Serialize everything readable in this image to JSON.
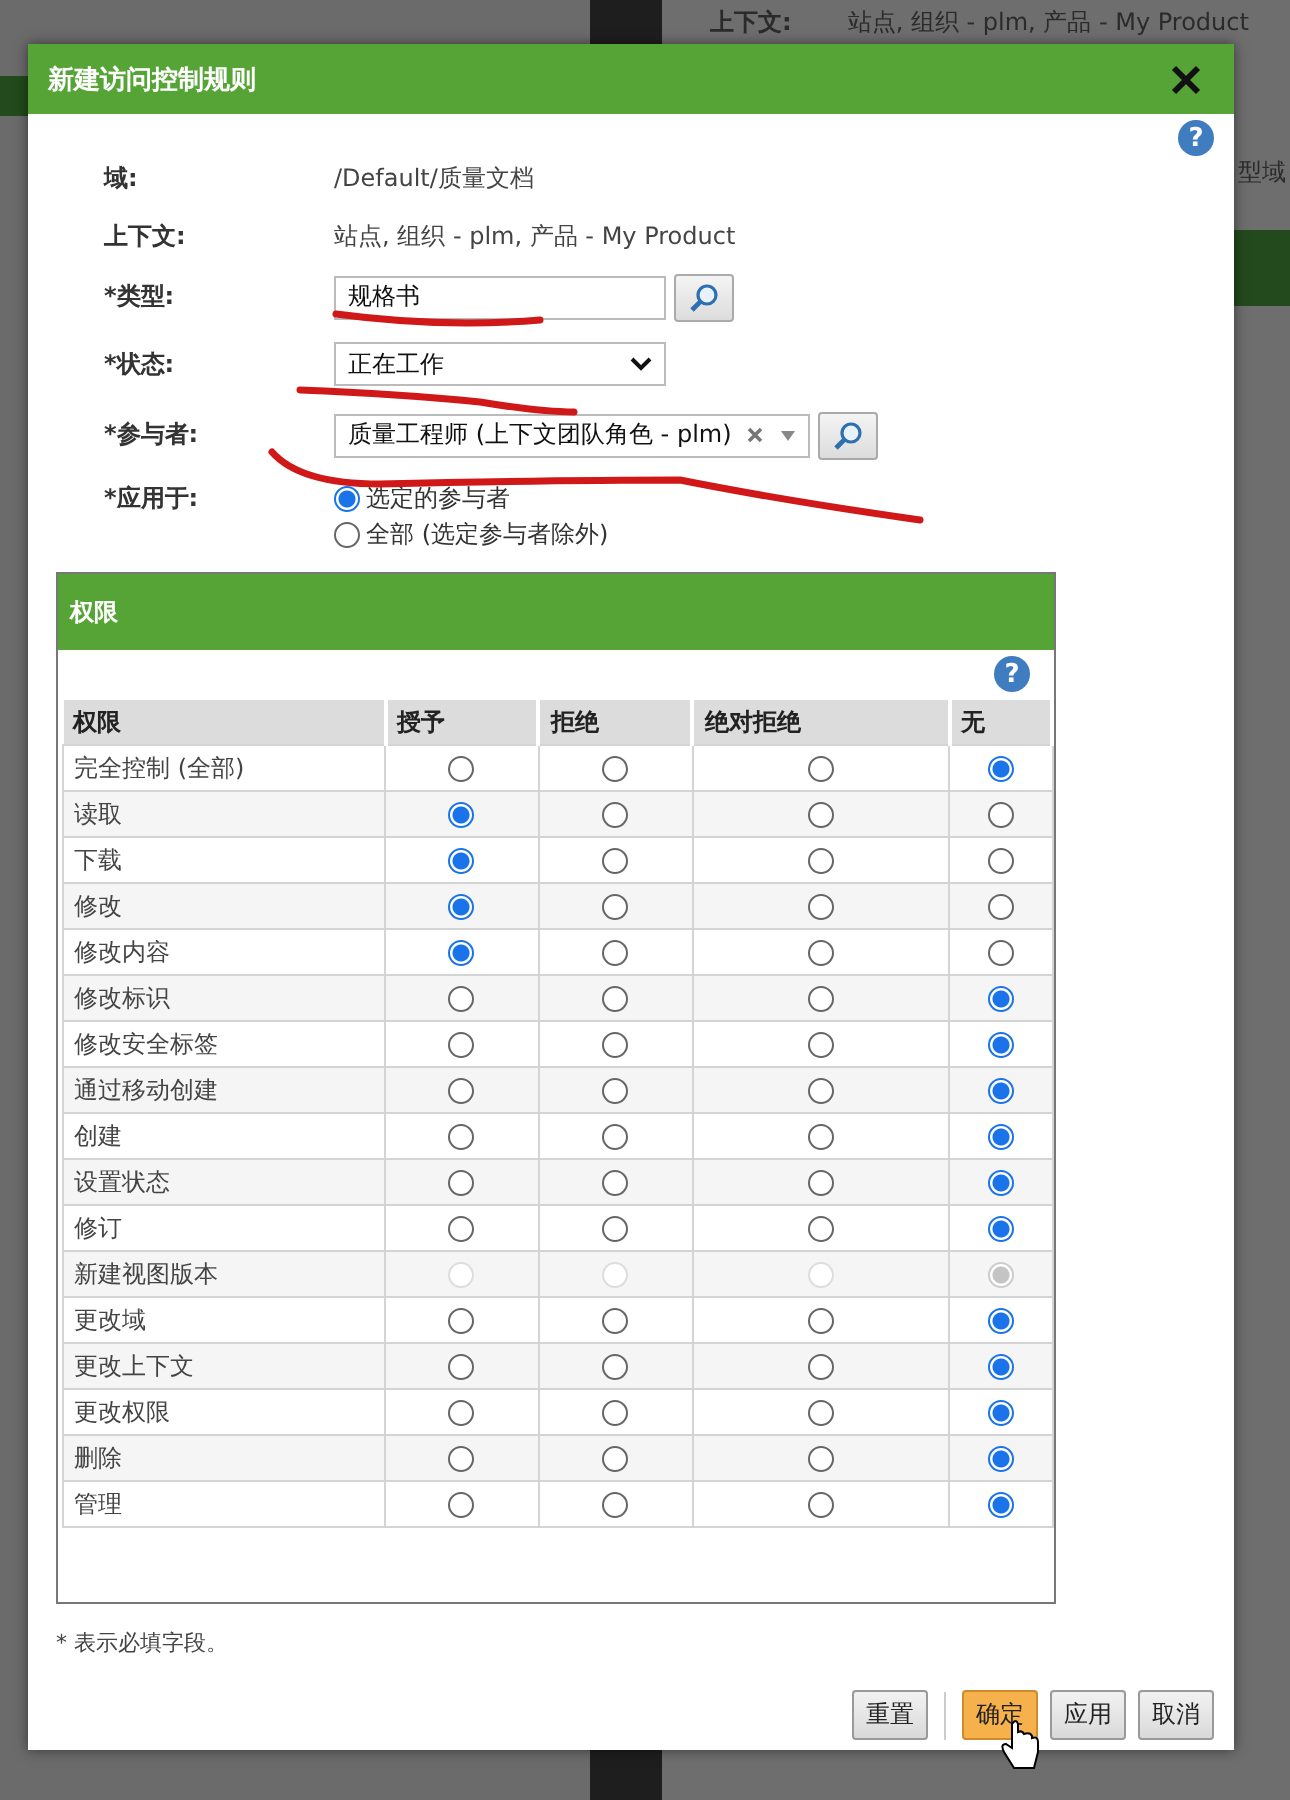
{
  "background": {
    "context_label": "上下文:",
    "context_value": "站点, 组织 - plm, 产品 - My Product",
    "side_text": "型域"
  },
  "dialog": {
    "title": "新建访问控制规则",
    "help": "?"
  },
  "fields": [
    {
      "kind": "text",
      "label": "域:",
      "value": "/Default/质量文档"
    },
    {
      "kind": "text",
      "label": "上下文:",
      "value": "站点, 组织 - plm, 产品 - My Product"
    },
    {
      "kind": "lookup",
      "label": "*类型:",
      "value": "规格书"
    },
    {
      "kind": "select",
      "label": "*状态:",
      "value": "正在工作"
    },
    {
      "kind": "multiselect",
      "label": "*参与者:",
      "value": "质量工程师 (上下文团队角色 - plm)"
    },
    {
      "kind": "radios",
      "label": "*应用于:",
      "options": [
        {
          "label": "选定的参与者",
          "selected": true
        },
        {
          "label": "全部 (选定参与者除外)",
          "selected": false
        }
      ]
    }
  ],
  "permissions": {
    "title": "权限",
    "help": "?",
    "columns": [
      "权限",
      "授予",
      "拒绝",
      "绝对拒绝",
      "无"
    ],
    "rows": [
      {
        "name": "完全控制 (全部)",
        "disabled": false,
        "options": [
          {
            "selected": false
          },
          {
            "selected": false
          },
          {
            "selected": false
          },
          {
            "selected": true
          }
        ]
      },
      {
        "name": "读取",
        "disabled": false,
        "options": [
          {
            "selected": true
          },
          {
            "selected": false
          },
          {
            "selected": false
          },
          {
            "selected": false
          }
        ]
      },
      {
        "name": "下载",
        "disabled": false,
        "options": [
          {
            "selected": true
          },
          {
            "selected": false
          },
          {
            "selected": false
          },
          {
            "selected": false
          }
        ]
      },
      {
        "name": "修改",
        "disabled": false,
        "options": [
          {
            "selected": true
          },
          {
            "selected": false
          },
          {
            "selected": false
          },
          {
            "selected": false
          }
        ]
      },
      {
        "name": "修改内容",
        "disabled": false,
        "options": [
          {
            "selected": true
          },
          {
            "selected": false
          },
          {
            "selected": false
          },
          {
            "selected": false
          }
        ]
      },
      {
        "name": "修改标识",
        "disabled": false,
        "options": [
          {
            "selected": false
          },
          {
            "selected": false
          },
          {
            "selected": false
          },
          {
            "selected": true
          }
        ]
      },
      {
        "name": "修改安全标签",
        "disabled": false,
        "options": [
          {
            "selected": false
          },
          {
            "selected": false
          },
          {
            "selected": false
          },
          {
            "selected": true
          }
        ]
      },
      {
        "name": "通过移动创建",
        "disabled": false,
        "options": [
          {
            "selected": false
          },
          {
            "selected": false
          },
          {
            "selected": false
          },
          {
            "selected": true
          }
        ]
      },
      {
        "name": "创建",
        "disabled": false,
        "options": [
          {
            "selected": false
          },
          {
            "selected": false
          },
          {
            "selected": false
          },
          {
            "selected": true
          }
        ]
      },
      {
        "name": "设置状态",
        "disabled": false,
        "options": [
          {
            "selected": false
          },
          {
            "selected": false
          },
          {
            "selected": false
          },
          {
            "selected": true
          }
        ]
      },
      {
        "name": "修订",
        "disabled": false,
        "options": [
          {
            "selected": false
          },
          {
            "selected": false
          },
          {
            "selected": false
          },
          {
            "selected": true
          }
        ]
      },
      {
        "name": "新建视图版本",
        "disabled": true,
        "options": [
          {
            "selected": false
          },
          {
            "selected": false
          },
          {
            "selected": false
          },
          {
            "selected": true
          }
        ]
      },
      {
        "name": "更改域",
        "disabled": false,
        "options": [
          {
            "selected": false
          },
          {
            "selected": false
          },
          {
            "selected": false
          },
          {
            "selected": true
          }
        ]
      },
      {
        "name": "更改上下文",
        "disabled": false,
        "options": [
          {
            "selected": false
          },
          {
            "selected": false
          },
          {
            "selected": false
          },
          {
            "selected": true
          }
        ]
      },
      {
        "name": "更改权限",
        "disabled": false,
        "options": [
          {
            "selected": false
          },
          {
            "selected": false
          },
          {
            "selected": false
          },
          {
            "selected": true
          }
        ]
      },
      {
        "name": "删除",
        "disabled": false,
        "options": [
          {
            "selected": false
          },
          {
            "selected": false
          },
          {
            "selected": false
          },
          {
            "selected": true
          }
        ]
      },
      {
        "name": "管理",
        "disabled": false,
        "options": [
          {
            "selected": false
          },
          {
            "selected": false
          },
          {
            "selected": false
          },
          {
            "selected": true
          }
        ]
      }
    ]
  },
  "note": "* 表示必填字段。",
  "buttons": [
    {
      "label": "重置",
      "primary": false
    },
    {
      "label": "确定",
      "primary": true
    },
    {
      "label": "应用",
      "primary": false
    },
    {
      "label": "取消",
      "primary": false
    }
  ]
}
